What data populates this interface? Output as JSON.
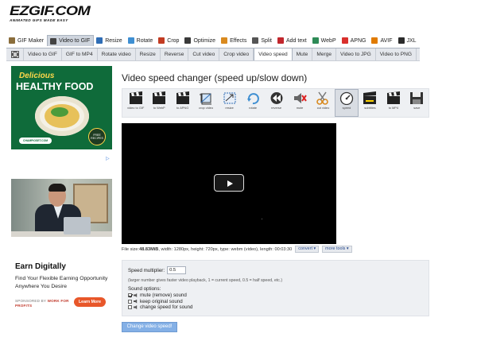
{
  "logo": {
    "text": "EZGIF.COM",
    "tagline": "ANIMATED GIFS MADE EASY"
  },
  "main_nav": [
    {
      "label": "GIF Maker",
      "icon": "gif-maker-icon",
      "color": "#8a6d3b"
    },
    {
      "label": "Video to GIF",
      "icon": "film-icon",
      "color": "#444444",
      "active": true
    },
    {
      "label": "Resize",
      "icon": "resize-icon",
      "color": "#2f6db5"
    },
    {
      "label": "Rotate",
      "icon": "rotate-icon",
      "color": "#3f8fd2"
    },
    {
      "label": "Crop",
      "icon": "crop-icon",
      "color": "#c23b22"
    },
    {
      "label": "Optimize",
      "icon": "optimize-icon",
      "color": "#3a3a3a"
    },
    {
      "label": "Effects",
      "icon": "effects-icon",
      "color": "#d98a1f"
    },
    {
      "label": "Split",
      "icon": "split-icon",
      "color": "#555555"
    },
    {
      "label": "Add text",
      "icon": "text-icon",
      "color": "#c1272d"
    },
    {
      "label": "WebP",
      "icon": "webp-icon",
      "color": "#2e8b57"
    },
    {
      "label": "APNG",
      "icon": "apng-icon",
      "color": "#d9302c"
    },
    {
      "label": "AVIF",
      "icon": "avif-icon",
      "color": "#e07b00"
    },
    {
      "label": "JXL",
      "icon": "jxl-icon",
      "color": "#2b2b2b"
    }
  ],
  "sub_nav": [
    {
      "label": "Video to GIF"
    },
    {
      "label": "GIF to MP4"
    },
    {
      "label": "Rotate video"
    },
    {
      "label": "Resize"
    },
    {
      "label": "Reverse"
    },
    {
      "label": "Cut video"
    },
    {
      "label": "Crop video"
    },
    {
      "label": "Video speed",
      "active": true
    },
    {
      "label": "Mute"
    },
    {
      "label": "Merge"
    },
    {
      "label": "Video to JPG"
    },
    {
      "label": "Video to PNG"
    }
  ],
  "ads": {
    "food": {
      "line1": "Delicious",
      "line2": "HEALTHY FOOD",
      "badge": "FREE RECIPES",
      "url": "CHAMPIOSET.COM"
    },
    "promo": {
      "headline": "Earn Digitally",
      "body": "Find Your Flexible Earning Opportunity Anywhere You Desire",
      "sponsor_prefix": "SPONSORED BY ",
      "sponsor_name": "WORK FOR PROFITS",
      "cta": "Learn More"
    }
  },
  "page_title": "Video speed changer (speed up/slow down)",
  "tools": [
    {
      "label": "video to GIF",
      "icon": "clapper-gif-icon"
    },
    {
      "label": "to WebP",
      "icon": "clapper-webp-icon"
    },
    {
      "label": "to APNG",
      "icon": "clapper-apng-icon"
    },
    {
      "label": "crop video",
      "icon": "crop-video-icon"
    },
    {
      "label": "resize",
      "icon": "resize-video-icon"
    },
    {
      "label": "rotate",
      "icon": "rotate-video-icon"
    },
    {
      "label": "reverse",
      "icon": "reverse-icon"
    },
    {
      "label": "mute",
      "icon": "mute-icon"
    },
    {
      "label": "cut video",
      "icon": "scissors-icon"
    },
    {
      "label": "speed",
      "icon": "speed-icon",
      "selected": true
    },
    {
      "label": "subtitles",
      "icon": "subtitles-icon"
    },
    {
      "label": "to MP4",
      "icon": "clapper-mp4-icon"
    },
    {
      "label": "save",
      "icon": "save-icon"
    }
  ],
  "file_info": {
    "prefix": "File size: ",
    "size": "48.83MiB",
    "details": ", width: 1280px, height: 720px, type: webm (video), length: 00:03:30",
    "convert_label": "convert",
    "more_tools_label": "more tools"
  },
  "form": {
    "multiplier_label": "Speed multiplier:",
    "multiplier_value": "0.5",
    "note": "(larger number gives faster video playback, 1 = current speed, 0.5 = half speed, etc.)",
    "sound_label": "Sound options:",
    "options": [
      {
        "label": "mute (remove) sound",
        "checked": true
      },
      {
        "label": "keep original sound",
        "checked": false
      },
      {
        "label": "change speed for sound",
        "checked": false
      }
    ],
    "submit_label": "Change video speed!"
  }
}
